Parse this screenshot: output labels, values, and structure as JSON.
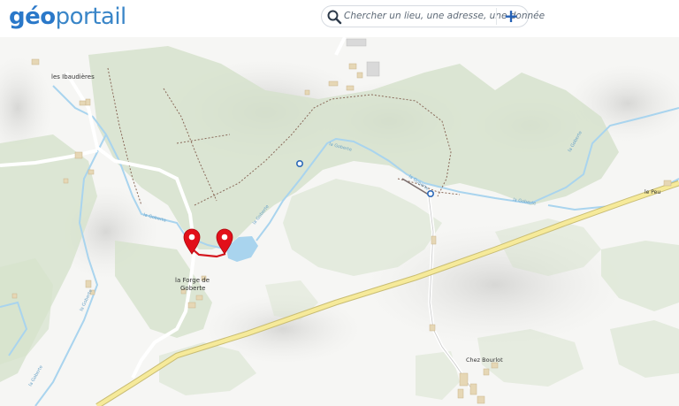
{
  "app": {
    "logo_geo": "géo",
    "logo_portail": "portail"
  },
  "search": {
    "placeholder": "Chercher un lieu, une adresse, une donnée",
    "add_label": "+"
  },
  "map": {
    "places": {
      "les_ibaudieres": "les Ibaudières",
      "forge_line1": "la Forge de",
      "forge_line2": "Goberte",
      "le_peu": "le Peu",
      "chez_bourlot": "Chez Bourlot"
    },
    "streams": {
      "goberte": "la Goberte"
    }
  },
  "colors": {
    "accent": "#2561b5",
    "marker": "#e2101a",
    "route": "#d4161e",
    "water": "#a9d4ee",
    "road": "#f6ea9a"
  }
}
